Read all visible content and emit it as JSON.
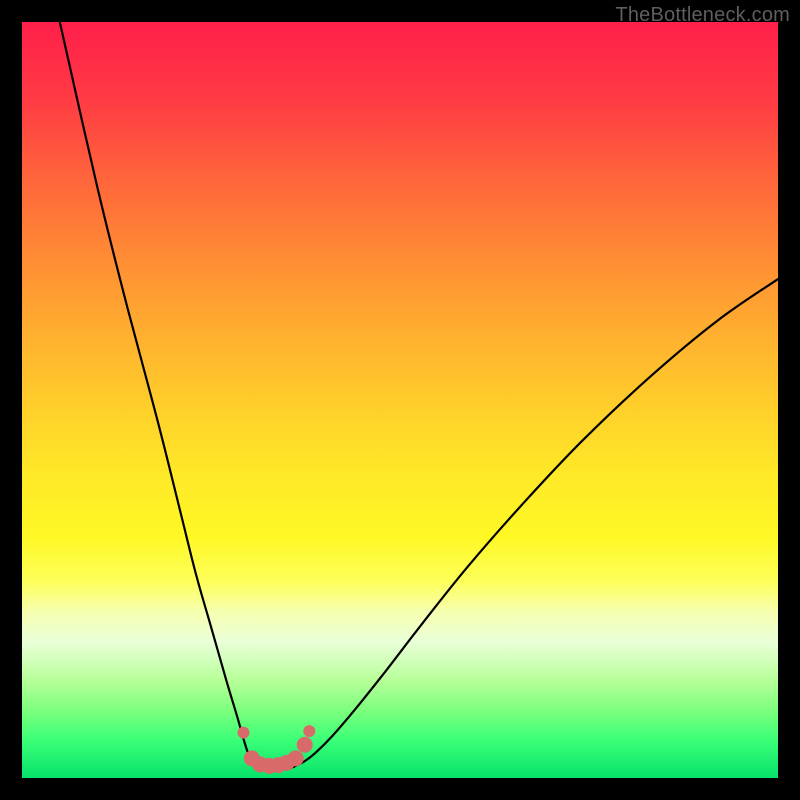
{
  "watermark": "TheBottleneck.com",
  "chart_data": {
    "type": "line",
    "title": "",
    "xlabel": "",
    "ylabel": "",
    "xlim": [
      0,
      100
    ],
    "ylim": [
      0,
      100
    ],
    "series": [
      {
        "name": "curve-left",
        "x": [
          5,
          10,
          14,
          18,
          21,
          23,
          25,
          27,
          28.5,
          29.5,
          30.2,
          30.8
        ],
        "y": [
          100,
          78,
          62,
          47,
          35,
          27,
          20,
          13,
          8,
          4.5,
          2.5,
          1.5
        ]
      },
      {
        "name": "curve-right",
        "x": [
          36,
          37.5,
          39,
          41,
          44,
          48,
          53,
          59,
          66,
          74,
          83,
          92,
          100
        ],
        "y": [
          1.5,
          2.3,
          3.5,
          5.5,
          9,
          14,
          20.5,
          28,
          36,
          44.5,
          53,
          60.5,
          66
        ]
      }
    ],
    "markers": {
      "name": "highlight-markers",
      "color": "#d96a6a",
      "points": [
        {
          "x": 29.3,
          "y": 6.0,
          "r": 6
        },
        {
          "x": 30.4,
          "y": 2.6,
          "r": 8
        },
        {
          "x": 31.5,
          "y": 1.8,
          "r": 8
        },
        {
          "x": 32.7,
          "y": 1.6,
          "r": 8
        },
        {
          "x": 33.9,
          "y": 1.7,
          "r": 8
        },
        {
          "x": 35.0,
          "y": 2.0,
          "r": 8
        },
        {
          "x": 36.2,
          "y": 2.6,
          "r": 8
        },
        {
          "x": 37.4,
          "y": 4.4,
          "r": 8
        },
        {
          "x": 38.0,
          "y": 6.2,
          "r": 6
        }
      ]
    },
    "trough": {
      "name": "trough-segment",
      "x": [
        30.8,
        32.0,
        33.5,
        35.0,
        36.0
      ],
      "y": [
        1.5,
        1.2,
        1.1,
        1.2,
        1.5
      ]
    }
  }
}
